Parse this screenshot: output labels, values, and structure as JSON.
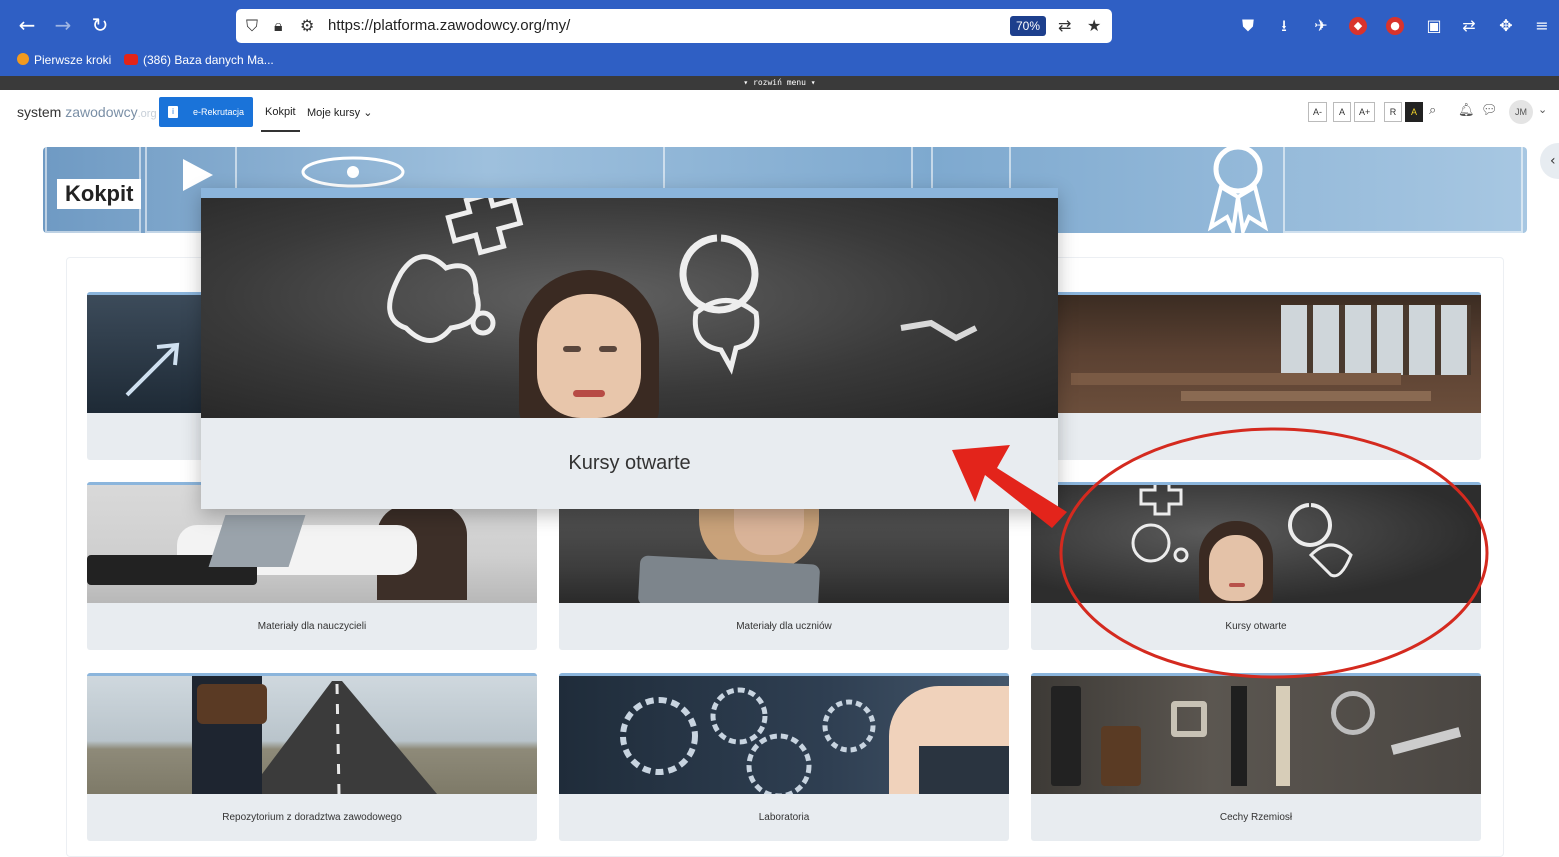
{
  "browser": {
    "url": "https://platforma.zawodowcy.org/my/",
    "zoom": "70%",
    "bookmarks": [
      "Pierwsze kroki",
      "(386) Baza danych Ma..."
    ],
    "menu_strip": "▾ rozwiń menu ▾"
  },
  "header": {
    "logo": {
      "part1": "system ",
      "part2": "zawodowcy",
      "part3": ".org"
    },
    "erekrutacja": "e-Rekrutacja",
    "nav": [
      "Kokpit",
      "Moje kursy"
    ],
    "font_buttons": [
      "A-",
      "A",
      "A+",
      "R",
      "A"
    ],
    "user_initials": "JM"
  },
  "banner": {
    "title": "Kokpit"
  },
  "popup": {
    "label": "Kursy otwarte"
  },
  "cards": [
    {
      "label": ""
    },
    {
      "label": ""
    },
    {
      "label": "Materiały dla nauczycieli"
    },
    {
      "label": "Materiały dla uczniów"
    },
    {
      "label": "Kursy otwarte"
    },
    {
      "label": "Repozytorium z doradztwa zawodowego"
    },
    {
      "label": "Laboratoria"
    },
    {
      "label": "Cechy Rzemiosł"
    }
  ],
  "colors": {
    "browser_bar": "#2f5fc4",
    "accent": "#1a73d9",
    "card_top": "#8bb5dc",
    "annotation": "#d42a1f"
  }
}
